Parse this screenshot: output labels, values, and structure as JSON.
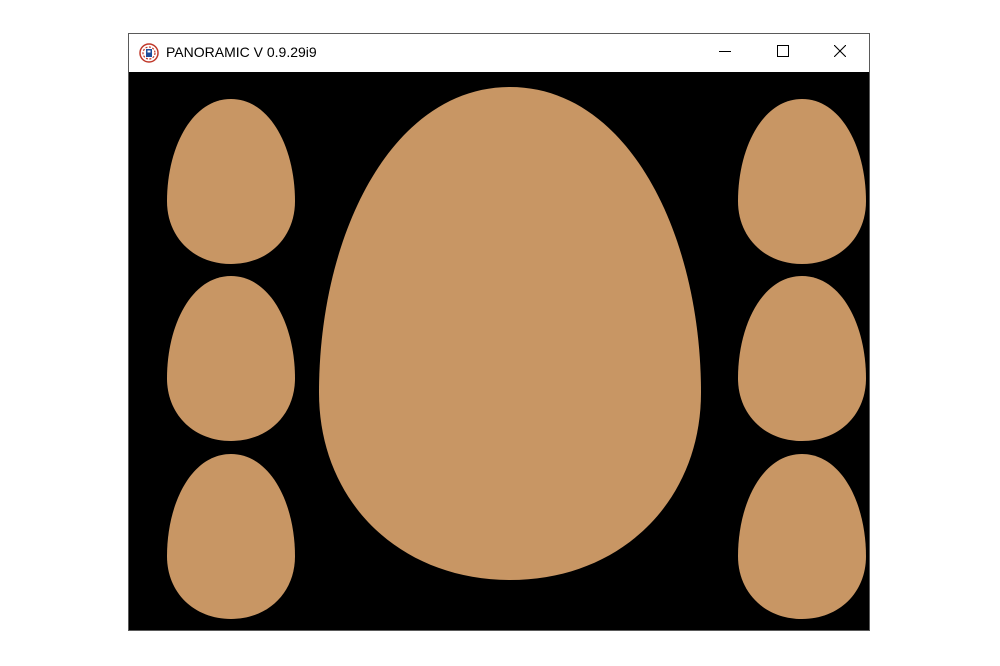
{
  "window": {
    "title": "PANORAMIC V 0.9.29i9",
    "icon": "panoramic-app-icon",
    "controls": {
      "minimize_icon": "minimize-icon",
      "maximize_icon": "maximize-icon",
      "close_icon": "close-icon"
    }
  },
  "canvas": {
    "background_color": "#000000",
    "egg_color": "#c89664",
    "egg_count": 7
  }
}
